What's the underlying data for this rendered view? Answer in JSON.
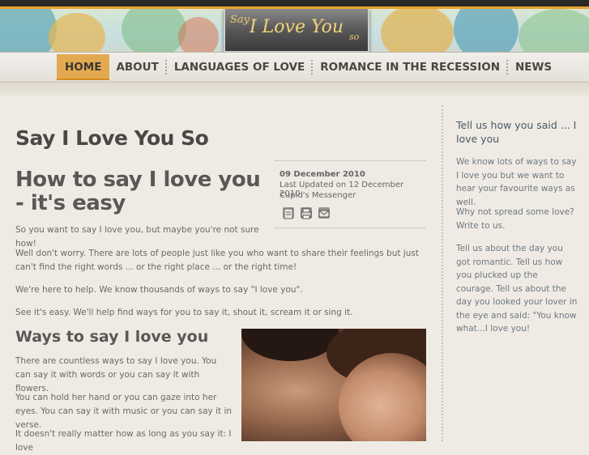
{
  "header": {
    "logo_say": "Say",
    "logo_main": "I Love You",
    "logo_so": "so"
  },
  "nav": {
    "items": [
      {
        "label": "HOME",
        "active": true
      },
      {
        "label": "ABOUT"
      },
      {
        "label": "LANGUAGES OF LOVE"
      },
      {
        "label": "ROMANCE IN THE RECESSION"
      },
      {
        "label": "NEWS"
      }
    ]
  },
  "main": {
    "site_title": "Say I Love You So",
    "article_title": "How to say I love you - it's easy",
    "meta": {
      "date": "09 December 2010",
      "updated": "Last Updated on 12 December 2010",
      "author": "Cupid's Messenger",
      "icons": [
        "pdf-icon",
        "print-icon",
        "email-icon"
      ]
    },
    "paragraphs": [
      "So you want to say I love you, but maybe you're not sure how!",
      "Well don't worry. There are lots of people just like you who want to share their feelings but just can't find the right words ... or the right place ... or the right time!",
      "We're here to help. We know thousands of ways to say \"I love you\".",
      "See it's easy. We'll help find ways for you to say it, shout it, scream it or sing it."
    ],
    "ways_heading": "Ways to say I love you",
    "ways_paragraphs": [
      "There are countless ways to say I love you. You can say it with words or you can say it with flowers.",
      "You can hold her hand or you can gaze into her eyes. You can say it with music or you can say it in verse.",
      "It doesn't really matter how as long as you say it: I love"
    ]
  },
  "sidebar": {
    "heading": "Tell us how you said ... I love you",
    "paragraphs": [
      "We know lots of ways to say I love you but we want to hear your favourite ways as well.",
      "Why not spread some love? Write to us.",
      "Tell us about the day you got romantic. Tell us how you plucked up the courage. Tell us about the day you looked your lover in the eye and said: \"You know what...I love you!"
    ]
  },
  "colors": {
    "accent": "#e3a950",
    "topbar": "#2b2926",
    "text": "#555555"
  }
}
